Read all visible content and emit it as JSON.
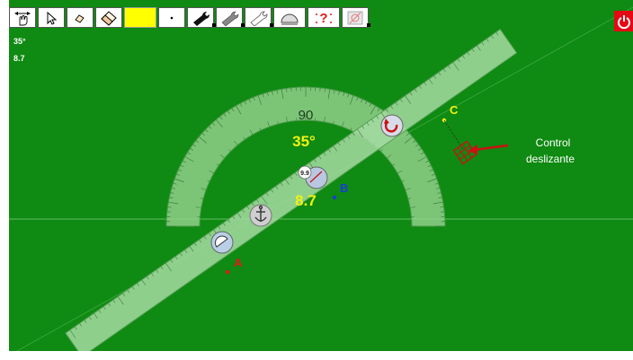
{
  "toolbar": {
    "tools": [
      {
        "name": "move-tool",
        "icon": "hand-move-icon"
      },
      {
        "name": "select-tool",
        "icon": "pointer-arrow-icon"
      },
      {
        "name": "eraser-tool",
        "icon": "small-eraser-icon"
      },
      {
        "name": "rubber-tool",
        "icon": "eraser-icon"
      },
      {
        "name": "color-tool",
        "icon": "color-swatch",
        "color": "#ffff00"
      },
      {
        "name": "point-tool",
        "icon": "dot-icon"
      },
      {
        "name": "wrench-dark-tool",
        "icon": "wrench-icon"
      },
      {
        "name": "wrench-gray-tool",
        "icon": "wrench-icon"
      },
      {
        "name": "wrench-light-tool",
        "icon": "wrench-icon"
      },
      {
        "name": "protractor-tool",
        "icon": "protractor-icon"
      },
      {
        "name": "help-tool",
        "icon": "question-icon"
      },
      {
        "name": "hide-tool",
        "icon": "hide-icon"
      }
    ]
  },
  "readouts": {
    "angle": "35°",
    "length": "8.7"
  },
  "protractor": {
    "center_label": "90",
    "angle_display": "35°",
    "length_display": "8.7",
    "knob_value": "9.9"
  },
  "points": {
    "a": "A",
    "b": "B",
    "c": "C"
  },
  "annotation": {
    "line1": "Control",
    "line2": "deslizante"
  },
  "colors": {
    "canvas": "#0f8a12",
    "ruler": "#8fcf8a",
    "label_red": "#e11919",
    "label_blue": "#1a3cd8",
    "label_yellow": "#f2f20e",
    "power": "#e50914"
  }
}
